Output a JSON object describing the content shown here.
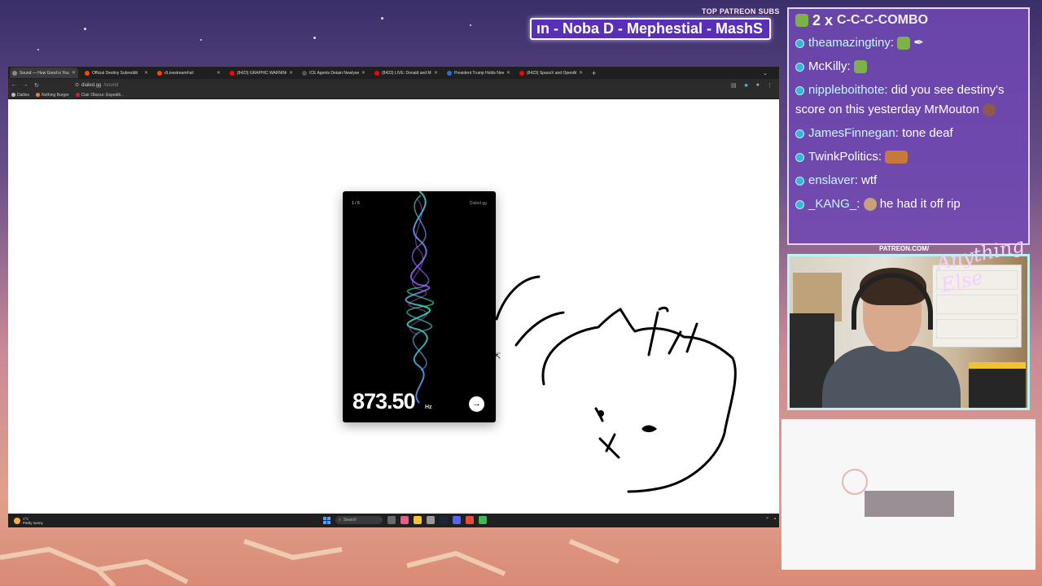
{
  "overlay": {
    "patreon_title": "TOP PATREON SUBS",
    "marquee": "ın -  Noba D - Mephestial - MashS"
  },
  "browser": {
    "tabs": [
      {
        "label": "Sound — How Good is You...",
        "fav": "#888888",
        "active": true
      },
      {
        "label": "Official Destiny Subreddit",
        "fav": "#ff4500",
        "active": false
      },
      {
        "label": "r/LivestreamFail",
        "fav": "#ff4500",
        "active": false
      },
      {
        "label": "(8423) GRAPHIC WARNING: Yo...",
        "fav": "#ff0000",
        "active": false
      },
      {
        "label": "ICE Agents Detain Newlywed S...",
        "fav": "#555555",
        "active": false
      },
      {
        "label": "(8423) LIVE: Donald and Melan...",
        "fav": "#ff0000",
        "active": false
      },
      {
        "label": "President Trump Holds News C...",
        "fav": "#2a6fdb",
        "active": false
      },
      {
        "label": "(8423) SpaceX and OpenAI",
        "fav": "#ff0000",
        "active": false
      }
    ],
    "url": {
      "domain": "dialed.gg",
      "path": "/sound"
    },
    "bookmarks": [
      {
        "label": "Dailies",
        "fav": "#bbbbbb"
      },
      {
        "label": "Nothing Burger",
        "fav": "#e8823a"
      },
      {
        "label": "Clair Obscur: Expediti...",
        "fav": "#d22222"
      }
    ]
  },
  "card": {
    "counter": "1 / 6",
    "brand": "Dialed.gg",
    "frequency": "873.50",
    "unit": "Hz"
  },
  "taskbar": {
    "temp": "1°C",
    "weather": "Partly sunny",
    "search": "Search"
  },
  "chat": {
    "combo_count": "2 x",
    "combo_text": "C-C-C-COMBO",
    "messages": [
      {
        "user": "theamazingtiny",
        "text": ""
      },
      {
        "user": "McKilly",
        "text": ""
      },
      {
        "user": "nippleboithote",
        "text": " did you see destiny's score on this yesterday MrMouton"
      },
      {
        "user": "JamesFinnegan",
        "text": " tone deaf"
      },
      {
        "user": "TwinkPolitics",
        "text": ""
      },
      {
        "user": "enslaver",
        "text": " wtf"
      },
      {
        "user": "_KANG_",
        "text": " he had it off rip"
      }
    ]
  },
  "webcam": {
    "patreon_label": "PATREON.COM/",
    "signature": "Anything Else"
  }
}
